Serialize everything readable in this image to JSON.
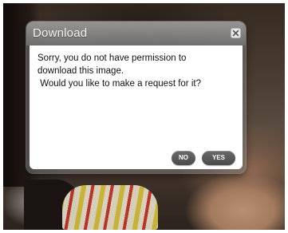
{
  "dialog": {
    "title": "Download",
    "close_icon": "close-icon",
    "message_lines": [
      "Sorry, you do not have permission to",
      "download this image.",
      " Would you like to make a request for it?"
    ],
    "buttons": {
      "no_label": "NO",
      "yes_label": "YES"
    }
  },
  "colors": {
    "title_bar": "#8c8c8c",
    "button": "#5a5a5a",
    "body": "#ffffff"
  }
}
